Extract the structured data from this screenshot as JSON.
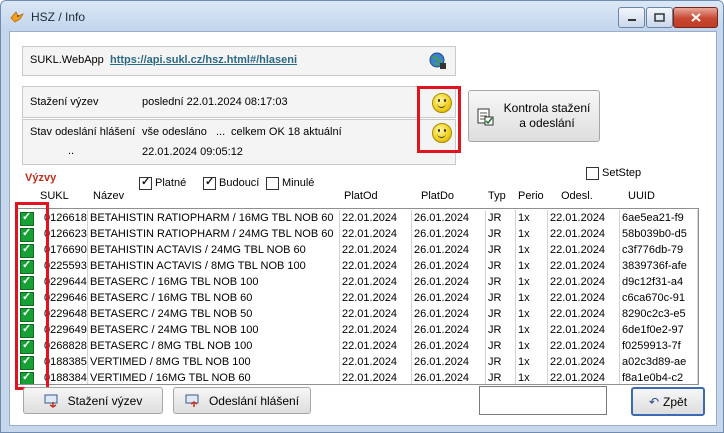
{
  "window": {
    "title": "HSZ / Info"
  },
  "webapp": {
    "label": "SUKL.WebApp",
    "url": "https://api.sukl.cz/hsz.html#/hlaseni"
  },
  "download": {
    "label": "Stažení výzev",
    "value": "poslední 22.01.2024 08:17:03"
  },
  "sending": {
    "label": "Stav odeslání hlášení",
    "status": "vše odesláno",
    "ellipsis": "...",
    "summary": "celkem OK 18 aktuální",
    "dots": "..",
    "datetime": "22.01.2024 09:05:12"
  },
  "check_button": {
    "label": "Kontrola stažení a odeslání"
  },
  "filters": {
    "section_label": "Výzvy",
    "platne": "Platné",
    "budouci": "Budoucí",
    "minule": "Minulé",
    "setstep": "SetStep",
    "platne_checked": true,
    "budouci_checked": true,
    "minule_checked": false,
    "setstep_checked": false
  },
  "table": {
    "headers": [
      "SUKL",
      "Název",
      "PlatOd",
      "PlatDo",
      "Typ",
      "Perio",
      "Odesl.",
      "UUID"
    ],
    "rows": [
      {
        "sukl": "0126618",
        "nazev": "BETAHISTIN RATIOPHARM / 16MG TBL NOB 60",
        "od": "22.01.2024",
        "do": "26.01.2024",
        "typ": "JR",
        "perio": "1x",
        "odesl": "22.01.2024",
        "uuid": "6ae5ea21-f9"
      },
      {
        "sukl": "0126623",
        "nazev": "BETAHISTIN RATIOPHARM / 24MG TBL NOB 60",
        "od": "22.01.2024",
        "do": "26.01.2024",
        "typ": "JR",
        "perio": "1x",
        "odesl": "22.01.2024",
        "uuid": "58b039b0-d5"
      },
      {
        "sukl": "0176690",
        "nazev": "BETAHISTIN ACTAVIS / 24MG TBL NOB 60",
        "od": "22.01.2024",
        "do": "26.01.2024",
        "typ": "JR",
        "perio": "1x",
        "odesl": "22.01.2024",
        "uuid": "c3f776db-79"
      },
      {
        "sukl": "0225593",
        "nazev": "BETAHISTIN ACTAVIS / 8MG TBL NOB 100",
        "od": "22.01.2024",
        "do": "26.01.2024",
        "typ": "JR",
        "perio": "1x",
        "odesl": "22.01.2024",
        "uuid": "3839736f-afe"
      },
      {
        "sukl": "0229644",
        "nazev": "BETASERC / 16MG TBL NOB 100",
        "od": "22.01.2024",
        "do": "26.01.2024",
        "typ": "JR",
        "perio": "1x",
        "odesl": "22.01.2024",
        "uuid": "d9c12f31-a4"
      },
      {
        "sukl": "0229646",
        "nazev": "BETASERC / 16MG TBL NOB 60",
        "od": "22.01.2024",
        "do": "26.01.2024",
        "typ": "JR",
        "perio": "1x",
        "odesl": "22.01.2024",
        "uuid": "c6ca670c-91"
      },
      {
        "sukl": "0229648",
        "nazev": "BETASERC / 24MG TBL NOB 50",
        "od": "22.01.2024",
        "do": "26.01.2024",
        "typ": "JR",
        "perio": "1x",
        "odesl": "22.01.2024",
        "uuid": "8290c2c3-e5"
      },
      {
        "sukl": "0229649",
        "nazev": "BETASERC / 24MG TBL NOB 100",
        "od": "22.01.2024",
        "do": "26.01.2024",
        "typ": "JR",
        "perio": "1x",
        "odesl": "22.01.2024",
        "uuid": "6de1f0e2-97"
      },
      {
        "sukl": "0268828",
        "nazev": "BETASERC / 8MG TBL NOB 100",
        "od": "22.01.2024",
        "do": "26.01.2024",
        "typ": "JR",
        "perio": "1x",
        "odesl": "22.01.2024",
        "uuid": "f0259913-7f"
      },
      {
        "sukl": "0188385",
        "nazev": "VERTIMED / 8MG TBL NOB 100",
        "od": "22.01.2024",
        "do": "26.01.2024",
        "typ": "JR",
        "perio": "1x",
        "odesl": "22.01.2024",
        "uuid": "a02c3d89-ae"
      },
      {
        "sukl": "0188384",
        "nazev": "VERTIMED / 16MG TBL NOB 60",
        "od": "22.01.2024",
        "do": "26.01.2024",
        "typ": "JR",
        "perio": "1x",
        "odesl": "22.01.2024",
        "uuid": "f8a1e0b4-c2"
      }
    ]
  },
  "buttons": {
    "stazeni": "Stažení výzev",
    "odeslani": "Odeslání hlášení",
    "zpet": "Zpět"
  },
  "icons": {
    "app": "bird-icon",
    "globe": "globe-icon",
    "smiley_download": "smiley-icon",
    "smiley_sending": "smiley-icon",
    "check": "document-check-icon"
  },
  "colors": {
    "highlight_red": "#e0141e",
    "check_green": "#18a035",
    "link": "#2b6a86"
  }
}
